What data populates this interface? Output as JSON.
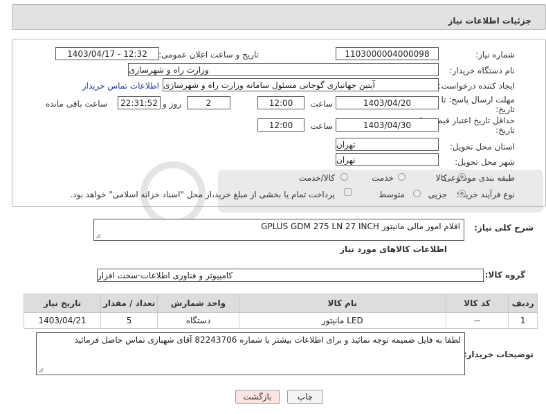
{
  "header": {
    "title": "جزئیات اطلاعات نیاز"
  },
  "fields": {
    "need_number_label": "شماره نیاز:",
    "need_number": "1103000004000098",
    "announce_label": "تاریخ و ساعت اعلان عمومی:",
    "announce_value": "1403/04/17 - 12:32",
    "buyer_org_label": "نام دستگاه خریدار:",
    "buyer_org": "وزارت راه و شهرسازی",
    "requester_label": "ایجاد کننده درخواست:",
    "requester": "آیتین جهانبازی گوجانی مسئول سامانه وزارت راه و شهرسازی",
    "contact_link": "اطلاعات تماس خریدار",
    "reply_deadline_label_1": "مهلت ارسال پاسخ: تا",
    "reply_deadline_label_2": "تاریخ:",
    "reply_date": "1403/04/20",
    "hour_label": "ساعت",
    "reply_time": "12:00",
    "days_value": "2",
    "days_label": "روز و",
    "remaining_value": "22:31:52",
    "remaining_label": "ساعت باقی مانده",
    "price_validity_label_1": "حداقل تاریخ اعتبار قیمت: تا",
    "price_validity_label_2": "تاریخ:",
    "validity_date": "1403/04/30",
    "validity_hour_label": "ساعت",
    "validity_time": "12:00",
    "province_label": "استان محل تحویل:",
    "province": "تهران",
    "city_label": "شهر محل تحویل:",
    "city": "تهران",
    "category_label": "طبقه بندی موضوعی:",
    "category_options": [
      "کالا",
      "خدمت",
      "کالا/خدمت"
    ],
    "purchase_type_label": "نوع فرآیند خرید :",
    "purchase_options": [
      "جزیی",
      "متوسط"
    ],
    "treasury_note": "پرداخت تمام یا بخشی از مبلغ خرید،از محل \"اسناد خزانه اسلامی\" خواهد بود."
  },
  "summary": {
    "label": "شرح کلی نیاز:",
    "value": "اقلام امور مالی مانیتور GPLUS GDM 275 LN 27 INCH"
  },
  "goods_section_title": "اطلاعات کالاهای مورد نیاز",
  "goods_group": {
    "label": "گروه کالا:",
    "value": "کامپیوتر و فناوری اطلاعات-سخت افزار"
  },
  "table": {
    "headers": [
      "ردیف",
      "کد کالا",
      "نام کالا",
      "واحد شمارش",
      "تعداد / مقدار",
      "تاریخ نیاز"
    ],
    "rows": [
      [
        "1",
        "--",
        "مانیتور LED",
        "دستگاه",
        "5",
        "1403/04/21"
      ]
    ]
  },
  "buyer_notes": {
    "label": "توضیحات خریدار:",
    "value": "لطفا به فایل ضمیمه توجه نمائید و برای اطلاعات بیشتر با شماره 82243706 آقای شهبازی تماس حاصل فرمائید"
  },
  "buttons": {
    "print": "چاپ",
    "back": "بازگشت"
  },
  "colors": {
    "header_bg": "#e2e2e2",
    "back_button_bg": "#fde3e3",
    "link": "#1a3ea8"
  }
}
